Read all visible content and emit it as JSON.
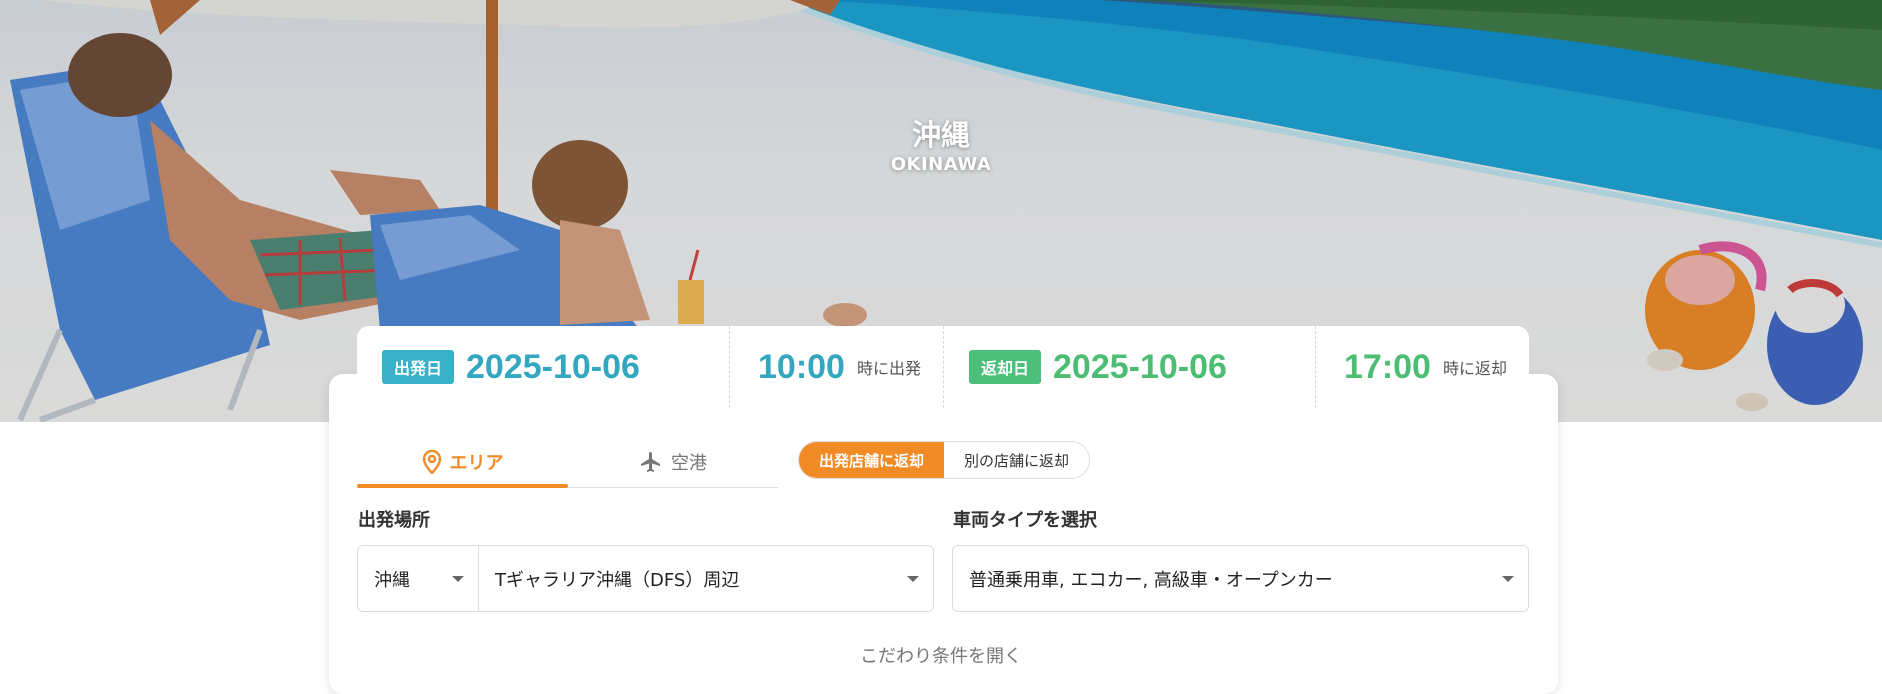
{
  "hero": {
    "title": "沖縄",
    "subtitle": "OKINAWA"
  },
  "dates": {
    "departure": {
      "badge": "出発日",
      "date": "2025-10-06"
    },
    "departure_time": {
      "time": "10:00",
      "suffix": "時に出発"
    },
    "return": {
      "badge": "返却日",
      "date": "2025-10-06"
    },
    "return_time": {
      "time": "17:00",
      "suffix": "時に返却"
    }
  },
  "tabs": [
    {
      "label": "エリア",
      "icon": "map-pin-icon",
      "active": true
    },
    {
      "label": "空港",
      "icon": "airplane-icon",
      "active": false
    }
  ],
  "return_toggle": {
    "options": [
      "出発店舗に返却",
      "別の店舗に返却"
    ],
    "selected": "出発店舗に返却"
  },
  "departure_place": {
    "label": "出発場所",
    "prefecture": "沖縄",
    "store": "Tギャラリア沖縄（DFS）周辺"
  },
  "vehicle_type": {
    "label": "車両タイプを選択",
    "value": "普通乗用車, エコカー, 高級車・オープンカー"
  },
  "more_conditions": "こだわり条件を開く",
  "colors": {
    "accent_orange": "#f18b26",
    "teal": "#33a7bf",
    "green": "#4cbd73"
  }
}
